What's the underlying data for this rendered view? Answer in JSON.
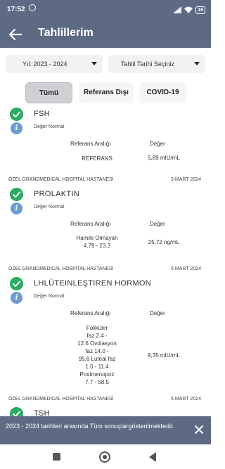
{
  "status_bar": {
    "time": "17:52",
    "battery": "16"
  },
  "app_bar": {
    "title": "Tahlillerim"
  },
  "filters": {
    "year": "Yıl: 2023 - 2024",
    "date": "Tahlil Tarihi Seçiniz"
  },
  "tabs": [
    {
      "label": "Tümü",
      "selected": true
    },
    {
      "label": "Referans Dışı",
      "selected": false
    },
    {
      "label": "COVID-19",
      "selected": false
    }
  ],
  "labels": {
    "range": "Referans Aralığı",
    "value": "Değer"
  },
  "tests": [
    {
      "hospital": "",
      "date": "",
      "name": "FSH",
      "note": "Değer Normal",
      "range": "REFERANS",
      "value": "5,89 mIU/mL"
    },
    {
      "hospital": "ÖZEL GRANDMEDICAL HOSPITAL HASTANESİ",
      "date": "5 MART 2024",
      "name": "PROLAKTIN",
      "note": "Değer Normal",
      "range": "Hamile Olmayan\n4.79 - 23.3",
      "value": "25,72 ng/mL"
    },
    {
      "hospital": "ÖZEL GRANDMEDICAL HOSPITAL HASTANESİ",
      "date": "5 MART 2024",
      "name": "LHLÜTEINLEŞTIREN HORMON",
      "note": "Değer Normal",
      "range": "Foliküler\nfaz 2.4 -\n12.6 Ovülasyon\nfaz 14.0 -\n95.6 Luteal faz\n1.0 - 11.4\nPostmenopoz\n7.7 - 58.5",
      "value": "9,35 mIU/mL"
    },
    {
      "hospital": "ÖZEL GRANDMEDICAL HOSPITAL HASTANESİ",
      "date": "5 MART 2024",
      "name": "TSH",
      "note": "",
      "range": "",
      "value": ""
    }
  ],
  "snackbar": {
    "message": "2023 - 2024 tarihleri arasında Tüm sonuçlargösterilmektedir."
  },
  "colors": {
    "primary": "#5e6a84",
    "success": "#27ae60",
    "info": "#6e9cd0"
  }
}
